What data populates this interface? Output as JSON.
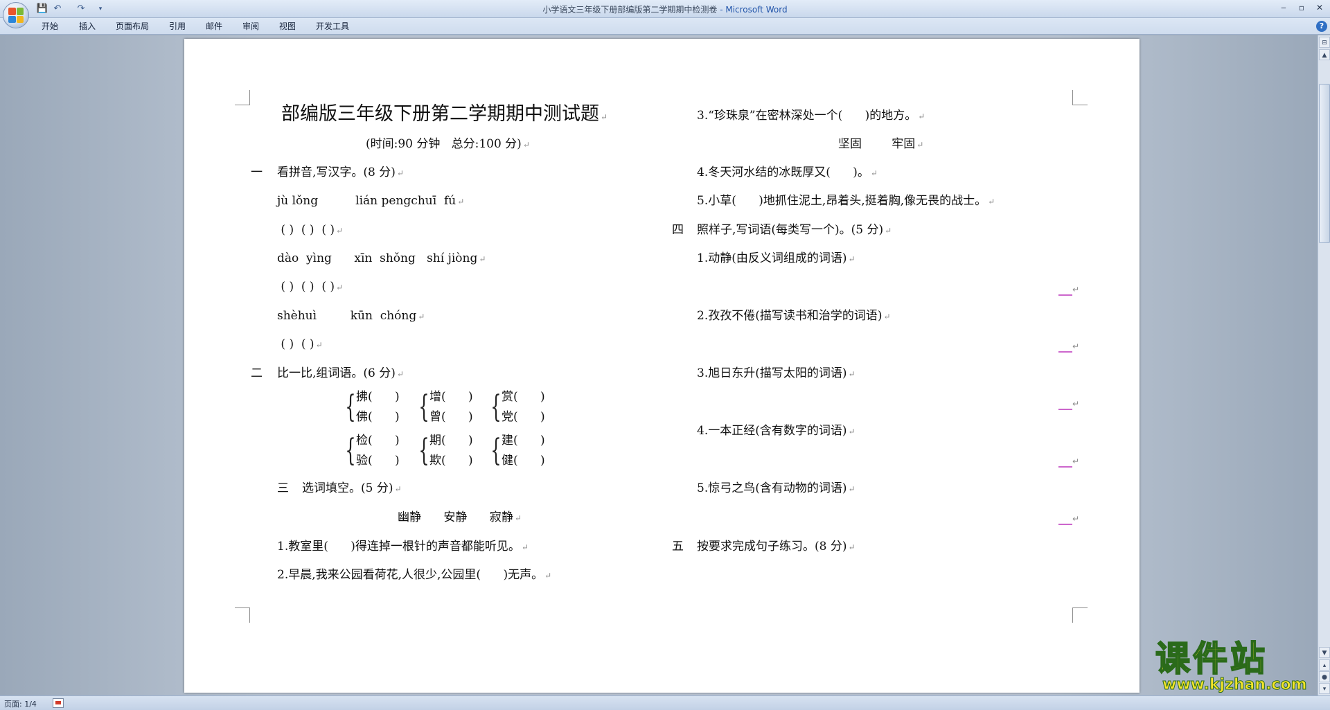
{
  "window": {
    "doc_name": "小学语文三年级下册部编版第二学期期中检测卷",
    "separator": " - ",
    "app_name": "Microsoft Word",
    "minimize": "‒",
    "restore": "▫",
    "close": "✕"
  },
  "qat": {
    "save": "💾",
    "undo": "↶",
    "redo": "↷",
    "more": "▾"
  },
  "ribbon_tabs": [
    "开始",
    "插入",
    "页面布局",
    "引用",
    "邮件",
    "审阅",
    "视图",
    "开发工具"
  ],
  "help": "?",
  "document": {
    "title": "部编版三年级下册第二学期期中测试题",
    "subtitle": "(时间:90 分钟   总分:100 分)",
    "s1": {
      "num": "一",
      "heading": "看拼音,写汉字。(8 分)"
    },
    "s1_lines": [
      "jù lǒng          lián pengchuī  fú",
      " ( )  ( )  ( )",
      "dào  yìng      xīn  shǒng   shí jiòng",
      " ( )  ( )  ( )",
      "shèhuì         kūn  chóng",
      " ( )  ( )"
    ],
    "s2": {
      "num": "二",
      "heading": "比一比,组词语。(6 分)"
    },
    "s2_groups": [
      [
        "拂(      )",
        "佛(      )"
      ],
      [
        "增(      )",
        "曾(      )"
      ],
      [
        "赏(      )",
        "党(      )"
      ],
      [
        "检(      )",
        "验(      )"
      ],
      [
        "期(      )",
        "欺(      )"
      ],
      [
        "建(      )",
        "健(      )"
      ]
    ],
    "s3": {
      "num": "三",
      "heading": "选词填空。(5 分)"
    },
    "s3_words": "幽静      安静      寂静",
    "s3_q1": "1.教室里(      )得连掉一根针的声音都能听见。",
    "s3_q2": "2.早晨,我来公园看荷花,人很少,公园里(      )无声。",
    "s3_q3": "3.“珍珠泉”在密林深处一个(      )的地方。",
    "s3_words2": "坚固        牢固",
    "s3_q4": "4.冬天河水结的冰既厚又(      )。",
    "s3_q5": "5.小草(      )地抓住泥土,昂着头,挺着胸,像无畏的战士。",
    "s4": {
      "num": "四",
      "heading": "照样子,写词语(每类写一个)。(5 分)"
    },
    "s4_items": [
      "1.动静(由反义词组成的词语)",
      "2.孜孜不倦(描写读书和治学的词语)",
      "3.旭日东升(描写太阳的词语)",
      "4.一本正经(含有数字的词语)",
      "5.惊弓之鸟(含有动物的词语)"
    ],
    "s5": {
      "num": "五",
      "heading": "按要求完成句子练习。(8 分)"
    },
    "para_mark": "↵"
  },
  "status": {
    "page": "页面: 1/4"
  },
  "watermark": {
    "main": "课件站",
    "url": "www.kjzhan.com"
  },
  "colors": {
    "title_app": "#2255aa",
    "answer_line": "#cc66cc",
    "page_bg": "#ffffff",
    "workspace": "#b9c4d2"
  }
}
